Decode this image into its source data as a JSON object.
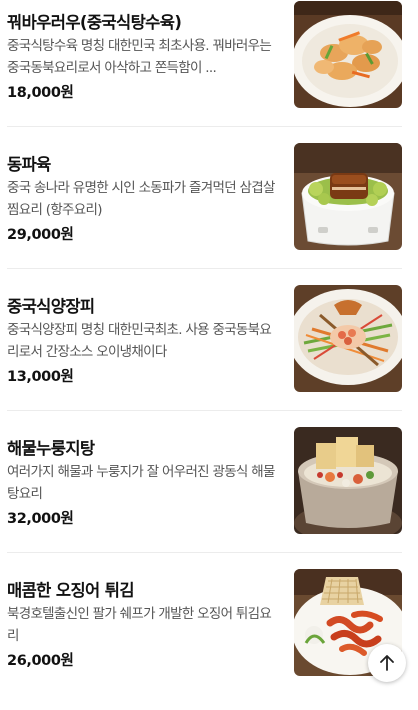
{
  "menu": {
    "items": [
      {
        "name": "꿔바우러우(중국식탕수육)",
        "description": "중국식탕수육 명칭 대한민국 최초사용. 꿔바러우는 중국동북요리로서 아삭하고 쫀득함이 ...",
        "price": "18,000원",
        "image": "sweet-sour-pork-photo"
      },
      {
        "name": "동파육",
        "description": "중국 송나라 유명한 시인 소동파가 즐겨먹던 삼겹살 찜요리 (항주요리)",
        "price": "29,000원",
        "image": "dongpo-pork-photo"
      },
      {
        "name": "중국식양장피",
        "description": "중국식양장피 명칭 대한민국최초. 사용 중국동북요리로서 간장소스 오이냉채이다",
        "price": "13,000원",
        "image": "yangjangpi-photo"
      },
      {
        "name": "해물누룽지탕",
        "description": "여러가지 해물과 누룽지가 잘 어우러진 광동식 해물탕요리",
        "price": "32,000원",
        "image": "seafood-rice-crust-soup-photo"
      },
      {
        "name": "매콤한 오징어 튀김",
        "description": "북경호텔출신인 팔가 쉐프가 개발한 오징어 튀김요리",
        "price": "26,000원",
        "image": "spicy-fried-squid-photo"
      }
    ]
  },
  "scroll_top": {
    "icon": "arrow-up-icon"
  },
  "colors": {
    "text": "#111111",
    "description": "#555555",
    "divider": "#ececec"
  }
}
